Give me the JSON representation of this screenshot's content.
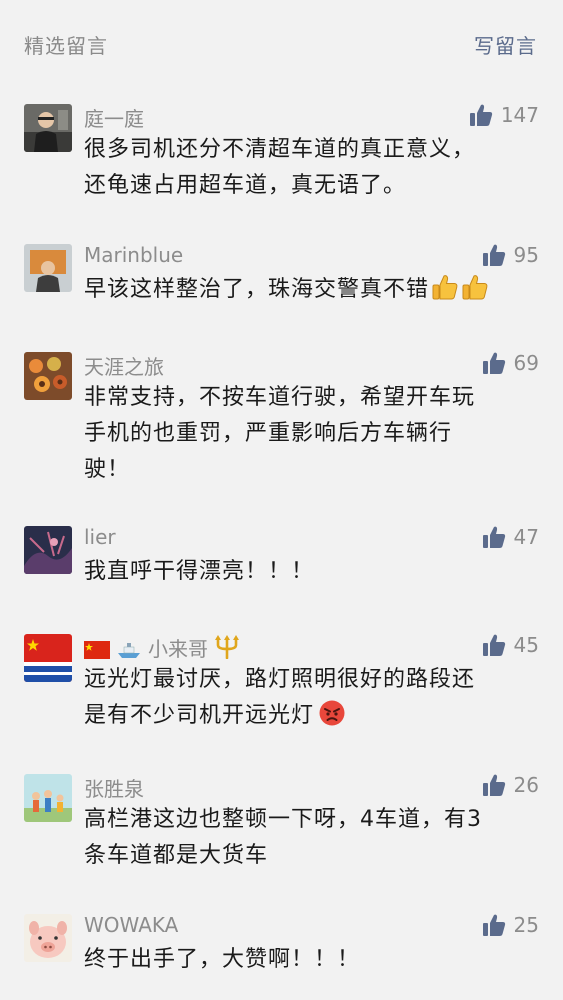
{
  "header": {
    "title": "精选留言",
    "write_label": "写留言"
  },
  "comments": [
    {
      "nick": "庭一庭",
      "likes": "147",
      "lines": [
        "很多司机还分不清超车道的真正意义，",
        "还龟速占用超车道，真无语了。"
      ]
    },
    {
      "nick": "Marinblue",
      "likes": "95",
      "lines": [
        "早该这样整治了，珠海交警真不错"
      ]
    },
    {
      "nick": "天涯之旅",
      "likes": "69",
      "lines": [
        "非常支持，不按车道行驶，希望开车玩",
        "手机的也重罚，严重影响后方车辆行",
        "驶！"
      ]
    },
    {
      "nick": "lier",
      "likes": "47",
      "lines": [
        "我直呼干得漂亮！！！"
      ]
    },
    {
      "nick": "小来哥",
      "likes": "45",
      "lines": [
        "远光灯最讨厌，路灯照明很好的路段还",
        "是有不少司机开远光灯"
      ]
    },
    {
      "nick": "张胜泉",
      "likes": "26",
      "lines": [
        "高栏港这边也整顿一下呀，4车道，有3",
        "条车道都是大货车"
      ]
    },
    {
      "nick": "WOWAKA",
      "likes": "25",
      "lines": [
        "终于出手了，大赞啊！！！"
      ]
    }
  ],
  "icons": {
    "like": "thumbs-up-icon",
    "thumb_emoji": "thumbs-up-emoji",
    "angry_emoji": "angry-face-emoji",
    "flag": "china-flag-icon",
    "ship": "ship-icon",
    "trident": "trident-icon"
  },
  "colors": {
    "link": "#5b6b8c",
    "like_icon": "#5b6b8c",
    "meta_text": "#8c8c8c",
    "body_text": "#1a1a1a",
    "background": "#f2f2f2"
  }
}
